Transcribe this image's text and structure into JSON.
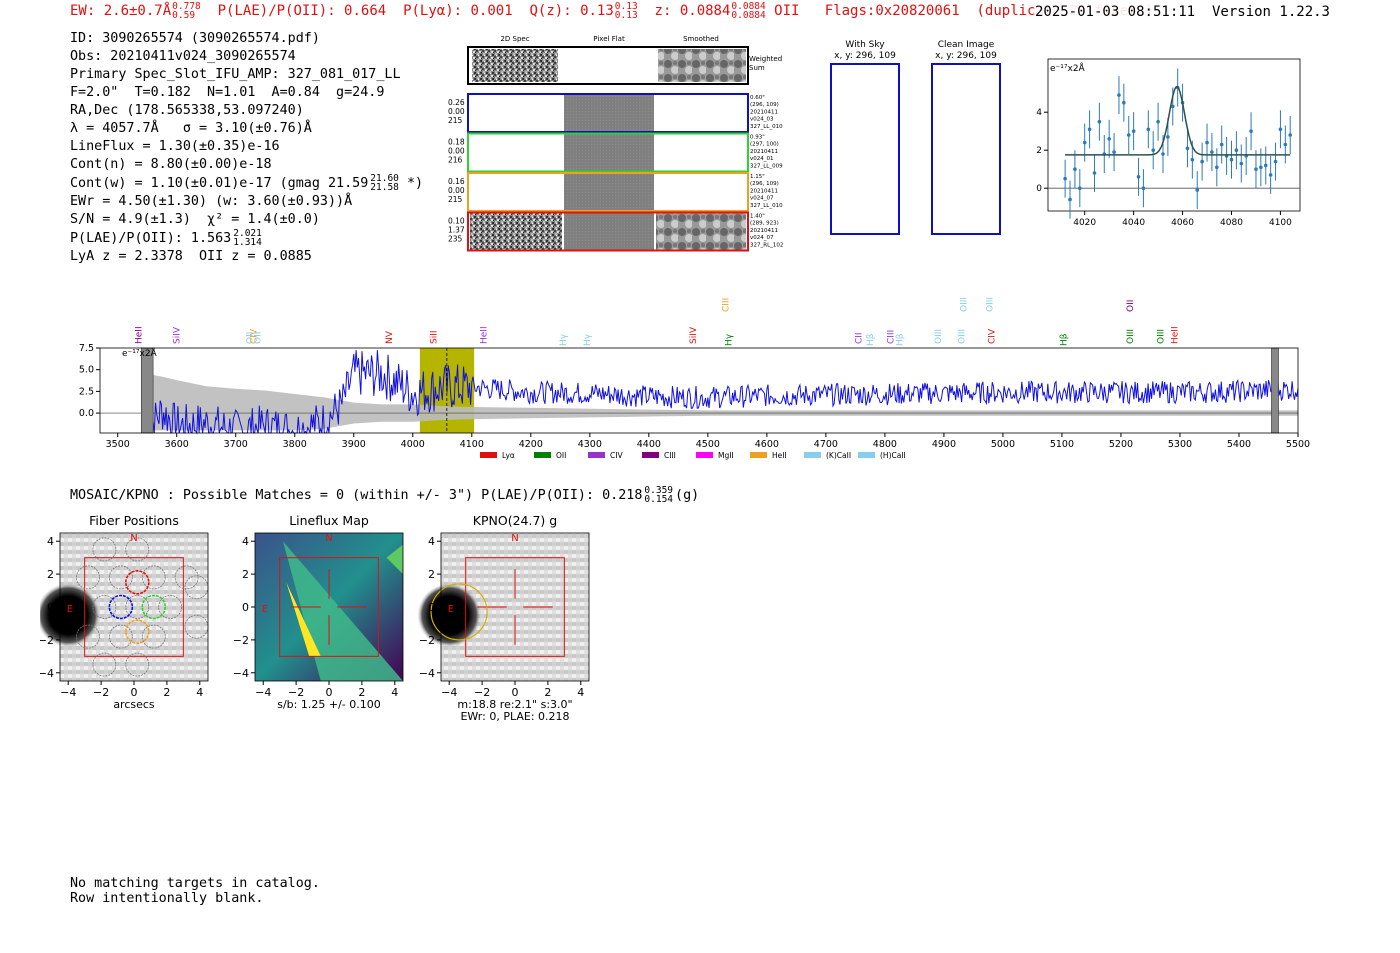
{
  "header": {
    "ew": "EW: 2.6±0.7Å",
    "ew_hi": "0.778",
    "ew_lo": "0.59",
    "plae_label": "P(LAE)/P(OII): 0.664",
    "plya": "P(Lyα): 0.001",
    "q": "Q(z): 0.13",
    "q_hi": "0.13",
    "q_lo": "0.13",
    "z": "z: 0.0884",
    "z_hi": "0.0884",
    "z_lo": "0.0884",
    "line": "OII",
    "flags": "Flags:0x20820061",
    "dup": "(duplicate 2D fibers)",
    "timestamp": "2025-01-03 08:51:11",
    "version": "Version 1.22.3"
  },
  "info": {
    "l1": "ID: 3090265574 (3090265574.pdf)",
    "l2": "Obs: 20210411v024_3090265574",
    "l3": "Primary Spec_Slot_IFU_AMP: 327_081_017_LL",
    "l4": "F=2.0\"  T=0.182  N=1.01  A=0.84  g=24.9",
    "l5": "RA,Dec (178.565338,53.097240)",
    "l6": "λ = 4057.7Å   σ = 3.10(±0.76)Å",
    "l7": "LineFlux = 1.30(±0.35)e-16",
    "l8": "Cont(n) = 8.80(±0.00)e-18",
    "l9": "Cont(w) = 1.10(±0.01)e-17 (gmag 21.59",
    "l9_hi": "21.60",
    "l9_lo": "21.58",
    "l9_end": "*)",
    "l10": "EWr = 4.50(±1.30) (w: 3.60(±0.93))Å",
    "l11": "S/N = 4.9(±1.3)  χ² = 1.4(±0.0)",
    "l12": "P(LAE)/P(OII): 1.563",
    "l12_hi": "2.021",
    "l12_lo": "1.314",
    "l13": "LyA z = 2.3378  OII z = 0.0885"
  },
  "cutouts": {
    "col1": "2D Spec",
    "col2": "Pixel Flat",
    "col3": "Smoothed",
    "weighted": "Weighted\nSum",
    "rows": [
      {
        "left": [
          "0.26",
          "0.00",
          "215"
        ],
        "right": [
          "0.60\"",
          "(296, 109)",
          "20210411",
          "v024_03",
          "327_LL_010"
        ],
        "color": "#1010c0"
      },
      {
        "left": [
          "0.18",
          "0.00",
          "216"
        ],
        "right": [
          "0.93\"",
          "(297, 100)",
          "20210411",
          "v024_01",
          "327_LL_009"
        ],
        "color": "#30d030"
      },
      {
        "left": [
          "0.16",
          "0.00",
          "215"
        ],
        "right": [
          "1.15\"",
          "(296, 109)",
          "20210411",
          "v024_07",
          "327_LL_010"
        ],
        "color": "#f0a020"
      },
      {
        "left": [
          "0.10",
          "1.37",
          "235"
        ],
        "right": [
          "1.40\"",
          "(289, 923)",
          "20210411",
          "v024_07",
          "327_RL_102"
        ],
        "color": "#e01010"
      }
    ]
  },
  "sky": {
    "title": "With Sky",
    "sub": "x, y: 296, 109"
  },
  "clean": {
    "title": "Clean Image",
    "sub": "x, y: 296, 109"
  },
  "zoom_units": "e⁻¹⁷x2Å",
  "full_units": "e⁻¹⁷x2Å",
  "line_labels": [
    {
      "name": "HeII",
      "w": 3540,
      "c": "#800080",
      "row": 0
    },
    {
      "name": "SiIV",
      "w": 3605,
      "c": "#9932cc",
      "row": 0
    },
    {
      "name": "OII",
      "w": 3728,
      "c": "#87ceeb",
      "row": 0
    },
    {
      "name": "CIV",
      "w": 3735,
      "c": "#f0a020",
      "row": 0
    },
    {
      "name": "OII",
      "w": 3742,
      "c": "#87ceeb",
      "row": 0
    },
    {
      "name": "NV",
      "w": 3965,
      "c": "#e01010",
      "row": 0
    },
    {
      "name": "SiII",
      "w": 4040,
      "c": "#e01010",
      "row": 0
    },
    {
      "name": "HeII",
      "w": 4125,
      "c": "#9932cc",
      "row": 0
    },
    {
      "name": "Hγ",
      "w": 4260,
      "c": "#87ceeb",
      "row": 1
    },
    {
      "name": "Hγ",
      "w": 4300,
      "c": "#87ceeb",
      "row": 1
    },
    {
      "name": "SiIV",
      "w": 4480,
      "c": "#e01010",
      "row": 0
    },
    {
      "name": "CIII",
      "w": 4535,
      "c": "#f0a020",
      "row": 2
    },
    {
      "name": "Hγ",
      "w": 4540,
      "c": "#008000",
      "row": 1
    },
    {
      "name": "CII",
      "w": 4760,
      "c": "#9932cc",
      "row": 0
    },
    {
      "name": "Hβ",
      "w": 4780,
      "c": "#87ceeb",
      "row": 1
    },
    {
      "name": "CIII",
      "w": 4815,
      "c": "#9932cc",
      "row": 0
    },
    {
      "name": "Hβ",
      "w": 4830,
      "c": "#87ceeb",
      "row": 1
    },
    {
      "name": "OIII",
      "w": 4895,
      "c": "#87ceeb",
      "row": 0
    },
    {
      "name": "OIII",
      "w": 4935,
      "c": "#87ceeb",
      "row": 0
    },
    {
      "name": "OIII",
      "w": 4938,
      "c": "#87ceeb",
      "row": 2
    },
    {
      "name": "OIII",
      "w": 4982,
      "c": "#87ceeb",
      "row": 2
    },
    {
      "name": "CIV",
      "w": 4986,
      "c": "#e01010",
      "row": 0
    },
    {
      "name": "Hβ",
      "w": 5108,
      "c": "#008000",
      "row": 1
    },
    {
      "name": "OIII",
      "w": 5220,
      "c": "#008000",
      "row": 0
    },
    {
      "name": "OII",
      "w": 5220,
      "c": "#800080",
      "row": 2
    },
    {
      "name": "OIII",
      "w": 5272,
      "c": "#008000",
      "row": 0
    },
    {
      "name": "HeII",
      "w": 5296,
      "c": "#e01010",
      "row": 0
    }
  ],
  "legend": [
    {
      "name": "Lyα",
      "color": "#e01010"
    },
    {
      "name": "OII",
      "color": "#008000"
    },
    {
      "name": "CIV",
      "color": "#9932cc"
    },
    {
      "name": "CIII",
      "color": "#800080"
    },
    {
      "name": "MgII",
      "color": "#ff00ff"
    },
    {
      "name": "HeII",
      "color": "#f0a020"
    },
    {
      "name": "(K)CaII",
      "color": "#87ceeb"
    },
    {
      "name": "(H)CaII",
      "color": "#87ceeb"
    }
  ],
  "mosaic": {
    "text": "MOSAIC/KPNO : Possible Matches = 0 (within +/- 3\")  P(LAE)/P(OII): 0.218",
    "hi": "0.359",
    "lo": "0.154",
    "end": "(g)"
  },
  "panels": [
    {
      "title": "Fiber Positions",
      "xlabel": "arcsecs",
      "sub1": "",
      "sub2": ""
    },
    {
      "title": "Lineflux Map",
      "xlabel": "s/b: 1.25 +/- 0.100",
      "sub1": "",
      "sub2": ""
    },
    {
      "title": "KPNO(24.7) g",
      "xlabel": "m:18.8  re:2.1\"  s:3.0\"",
      "sub1": "EWr: 0, PLAE: 0.218",
      "sub2": ""
    }
  ],
  "panel_ticks": {
    "x": [
      "−4",
      "−2",
      "0",
      "2",
      "4"
    ],
    "y": [
      "4",
      "2",
      "0",
      "−2",
      "−4"
    ]
  },
  "compass": {
    "n": "N",
    "e": "E"
  },
  "bottom": {
    "l1": "No matching targets in catalog.",
    "l2": "Row intentionally blank."
  },
  "chart_data": [
    {
      "type": "scatter",
      "title": "",
      "ylabel": "e⁻¹⁷x2Å",
      "xlim": [
        4005,
        4108
      ],
      "ylim": [
        -1.2,
        6.8
      ],
      "xticks": [
        4020,
        4040,
        4060,
        4080,
        4100
      ],
      "yticks": [
        0,
        2,
        4
      ],
      "x": [
        4012,
        4014,
        4016,
        4018,
        4020,
        4022,
        4024,
        4026,
        4028,
        4030,
        4032,
        4034,
        4036,
        4038,
        4040,
        4042,
        4044,
        4046,
        4048,
        4050,
        4052,
        4054,
        4056,
        4058,
        4060,
        4062,
        4064,
        4066,
        4068,
        4070,
        4072,
        4074,
        4076,
        4078,
        4080,
        4082,
        4084,
        4086,
        4088,
        4090,
        4092,
        4094,
        4096,
        4098,
        4100,
        4102,
        4104
      ],
      "y": [
        0.5,
        -0.6,
        1.0,
        0.0,
        2.4,
        3.1,
        0.8,
        3.5,
        1.8,
        2.6,
        1.9,
        4.9,
        4.5,
        2.8,
        3.0,
        0.6,
        0.0,
        3.1,
        2.0,
        3.5,
        1.8,
        2.7,
        4.3,
        5.3,
        4.5,
        2.1,
        1.5,
        -0.1,
        1.4,
        2.4,
        1.9,
        1.1,
        2.3,
        1.7,
        1.5,
        2.0,
        1.3,
        1.7,
        3.0,
        1.0,
        1.1,
        1.2,
        0.7,
        1.4,
        3.1,
        2.3,
        2.8
      ],
      "err": [
        1.0,
        1.0,
        1.0,
        1.0,
        1.0,
        1.0,
        1.0,
        1.0,
        1.0,
        1.0,
        1.0,
        1.0,
        1.0,
        1.0,
        1.0,
        1.0,
        1.0,
        1.0,
        1.0,
        1.0,
        1.0,
        1.0,
        1.0,
        1.0,
        1.0,
        1.0,
        1.0,
        1.0,
        1.0,
        1.0,
        1.0,
        1.0,
        1.0,
        1.0,
        1.0,
        1.0,
        1.0,
        1.0,
        1.0,
        1.0,
        1.0,
        1.0,
        1.0,
        1.0,
        1.0,
        1.0,
        1.0
      ],
      "fit": {
        "continuum": 1.75,
        "amplitude": 3.6,
        "center": 4057.7,
        "sigma": 3.1,
        "x_range": [
          4012,
          4104
        ]
      }
    },
    {
      "type": "line",
      "title": "",
      "ylabel": "e⁻¹⁷x2Å",
      "xlim": [
        3470,
        5500
      ],
      "ylim": [
        -2.3,
        7.5
      ],
      "xticks": [
        3500,
        3600,
        3700,
        3800,
        3900,
        4000,
        4100,
        4200,
        4300,
        4400,
        4500,
        4600,
        4700,
        4800,
        4900,
        5000,
        5100,
        5200,
        5300,
        5400,
        5500
      ],
      "yticks": [
        0.0,
        2.5,
        5.0,
        7.5
      ],
      "highlight": [
        4012,
        4104
      ],
      "marker": 4057.7,
      "masks": [
        [
          3540,
          3560
        ],
        [
          5455,
          5467
        ]
      ],
      "series": [
        {
          "color": "#1010e0",
          "x": [
            3550,
            3575,
            3600,
            3650,
            3700,
            3750,
            3800,
            3850,
            3880,
            3900,
            3950,
            4000,
            4050,
            4100,
            4200,
            4300,
            4400,
            4500,
            4600,
            4700,
            4800,
            4900,
            5000,
            5100,
            5200,
            5300,
            5400,
            5500
          ],
          "y": [
            -2.0,
            0.3,
            -1.5,
            -1.2,
            -2.0,
            -1.5,
            -2.0,
            -1.0,
            1.0,
            4.5,
            4.5,
            2.3,
            3.0,
            3.0,
            2.4,
            2.3,
            1.9,
            1.8,
            2.0,
            2.1,
            2.2,
            2.3,
            2.4,
            2.4,
            2.4,
            2.4,
            2.5,
            2.8
          ]
        },
        {
          "color": "#bbbbbb",
          "x": [
            3550,
            3575,
            3600,
            3650,
            3700,
            3750,
            3800,
            3850,
            3900,
            3950,
            4000,
            4050,
            4100,
            4200,
            4300,
            4400,
            4500,
            4600,
            4700,
            4800,
            4900,
            5000,
            5100,
            5200,
            5300,
            5400,
            5500
          ],
          "y": [
            4.5,
            4.2,
            3.8,
            3.1,
            2.8,
            2.6,
            2.2,
            1.8,
            1.2,
            1.0,
            1.0,
            0.8,
            0.7,
            0.6,
            0.5,
            0.4,
            0.3,
            0.3,
            0.3,
            0.3,
            0.3,
            0.3,
            0.3,
            0.3,
            0.3,
            0.3,
            0.3
          ]
        }
      ]
    }
  ]
}
